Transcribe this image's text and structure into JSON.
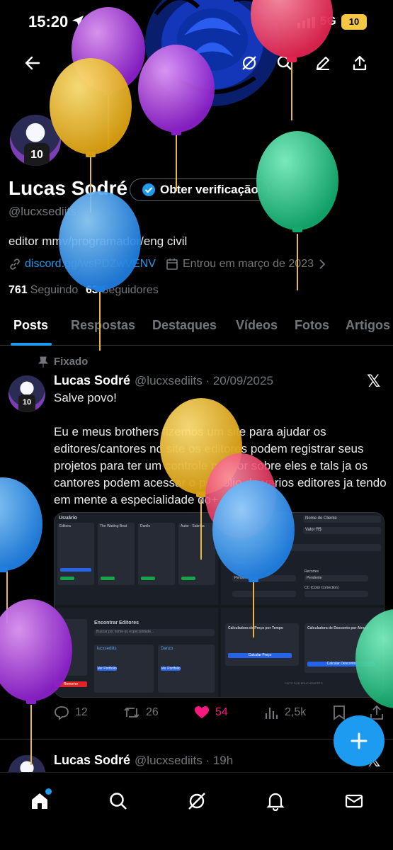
{
  "status_bar": {
    "time": "15:20",
    "network": "5G",
    "battery": "10"
  },
  "profile": {
    "name": "Lucas Sodré",
    "verify_label": "Obter verificação",
    "handle": "@lucxsediits",
    "bio": "editor mmv/programador/eng civil",
    "link": "discord.gg/wsPDZwVENV",
    "joined": "Entrou em março de 2023",
    "following_count": "761",
    "following_label": "Seguindo",
    "followers_count": "63",
    "followers_label": "Seguidores",
    "avatar_jersey": "10"
  },
  "tabs": [
    "Posts",
    "Respostas",
    "Destaques",
    "Vídeos",
    "Fotos",
    "Artigos"
  ],
  "pinned_post": {
    "pinned_label": "Fixado",
    "author": "Lucas Sodré",
    "handle_date": "@lucxsediits · 20/09/2025",
    "line1": "Salve povo!",
    "body": "Eu e meus brothers fizemos um site para ajudar os editores/cantores no site os editores podem registrar seus projetos para ter um controle melhor sobre eles e tals ja os cantores podem acessar o portfolio de varios editores ja tendo em mente a especialidade do+",
    "replies": "12",
    "reposts": "26",
    "likes": "54",
    "views": "2,5k"
  },
  "media": {
    "panel1_title": "Usuário",
    "panel1_cards": [
      "Editora",
      "The Waiting Beat",
      "Danilo",
      "Autor - Sabrina"
    ],
    "panel2_labels": [
      "Nome do Cliente",
      "Valor R$",
      "Status",
      "Pendente",
      "Recortes",
      "CC (Color Correction)"
    ],
    "panel3_title": "Encontrar Editores",
    "panel3_search": "Buscar por nome ou especialidade...",
    "panel3_cards": [
      "lucxsediits",
      "Danzo"
    ],
    "panel3_button": "Ver Portfolio",
    "panel3_red": "Remover",
    "panel4_left_title": "Calculadora de Preço por Tempo",
    "panel4_left_btn": "Calcular Preço",
    "panel4_right_title": "Calculadora de Desconto por Atraso",
    "panel4_right_btn": "Calcular Desconto",
    "footer": "FEITO POR BRUCHZWERTS"
  },
  "next_post": {
    "author": "Lucas Sodré",
    "handle_date": "@lucxsediits · 19h"
  },
  "colors": {
    "accent": "#1d9bf0",
    "like": "#f91880",
    "muted": "#71767b"
  }
}
